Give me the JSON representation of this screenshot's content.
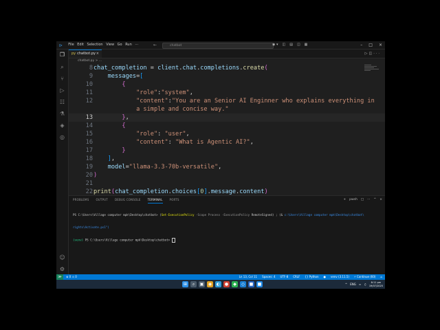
{
  "titlebar": {
    "menus": [
      "File",
      "Edit",
      "Selection",
      "View",
      "Go",
      "Run",
      "···"
    ],
    "nav": "← →",
    "search": "chatbot"
  },
  "activity_icons": [
    "files-icon",
    "search-icon",
    "source-control-icon",
    "run-debug-icon",
    "extensions-icon",
    "testing-icon",
    "python-icon",
    "remote-explorer-icon",
    "account-icon",
    "settings-icon"
  ],
  "tab": {
    "icon": "py",
    "label": "chatbot.py",
    "close": "×"
  },
  "breadcrumb": "chatbot.py > ...",
  "editor": {
    "lines": [
      {
        "num": "8",
        "segments": [
          [
            "chat_completion ",
            "#9cdcfe"
          ],
          [
            "= ",
            "#d4d4d4"
          ],
          [
            "client",
            "#9cdcfe"
          ],
          [
            ".",
            "#d4d4d4"
          ],
          [
            "chat",
            "#9cdcfe"
          ],
          [
            ".",
            "#d4d4d4"
          ],
          [
            "completions",
            "#9cdcfe"
          ],
          [
            ".",
            "#d4d4d4"
          ],
          [
            "create",
            "#dcdcaa"
          ],
          [
            "(",
            "#da70d6"
          ]
        ]
      },
      {
        "num": "9",
        "segments": [
          [
            "    messages",
            "#9cdcfe"
          ],
          [
            "=",
            "#d4d4d4"
          ],
          [
            "[",
            "#179fff"
          ]
        ]
      },
      {
        "num": "10",
        "segments": [
          [
            "        {",
            "#da70d6"
          ]
        ]
      },
      {
        "num": "11",
        "segments": [
          [
            "            ",
            "#d4d4d4"
          ],
          [
            "\"role\"",
            "#ce9178"
          ],
          [
            ":",
            "#d4d4d4"
          ],
          [
            "\"system\"",
            "#ce9178"
          ],
          [
            ",",
            "#d4d4d4"
          ]
        ]
      },
      {
        "num": "12",
        "segments": [
          [
            "            ",
            "#d4d4d4"
          ],
          [
            "\"content\"",
            "#ce9178"
          ],
          [
            ":",
            "#d4d4d4"
          ],
          [
            "\"You are an Senior AI Enginner who explains everything in",
            "#ce9178"
          ]
        ]
      },
      {
        "num": "",
        "segments": [
          [
            "            a simple and concise way.\"",
            "#ce9178"
          ]
        ]
      },
      {
        "num": "13",
        "segments": [
          [
            "        }",
            "#da70d6"
          ],
          [
            ",",
            "#d4d4d4"
          ]
        ],
        "current": true
      },
      {
        "num": "14",
        "segments": [
          [
            "        {",
            "#da70d6"
          ]
        ]
      },
      {
        "num": "15",
        "segments": [
          [
            "            ",
            "#d4d4d4"
          ],
          [
            "\"role\"",
            "#ce9178"
          ],
          [
            ": ",
            "#d4d4d4"
          ],
          [
            "\"user\"",
            "#ce9178"
          ],
          [
            ",",
            "#d4d4d4"
          ]
        ]
      },
      {
        "num": "16",
        "segments": [
          [
            "            ",
            "#d4d4d4"
          ],
          [
            "\"content\"",
            "#ce9178"
          ],
          [
            ": ",
            "#d4d4d4"
          ],
          [
            "\"What is Agentic AI?\"",
            "#ce9178"
          ],
          [
            ",",
            "#d4d4d4"
          ]
        ]
      },
      {
        "num": "17",
        "segments": [
          [
            "        }",
            "#da70d6"
          ]
        ]
      },
      {
        "num": "18",
        "segments": [
          [
            "    ]",
            "#179fff"
          ],
          [
            ",",
            "#d4d4d4"
          ]
        ]
      },
      {
        "num": "19",
        "segments": [
          [
            "    model",
            "#9cdcfe"
          ],
          [
            "=",
            "#d4d4d4"
          ],
          [
            "\"llama-3.3-70b-versatile\"",
            "#ce9178"
          ],
          [
            ",",
            "#d4d4d4"
          ]
        ]
      },
      {
        "num": "20",
        "segments": [
          [
            ")",
            "#da70d6"
          ]
        ]
      },
      {
        "num": "21",
        "segments": []
      },
      {
        "num": "22",
        "segments": [
          [
            "print",
            "#dcdcaa"
          ],
          [
            "(",
            "#da70d6"
          ],
          [
            "chat_completion",
            "#9cdcfe"
          ],
          [
            ".",
            "#d4d4d4"
          ],
          [
            "choices",
            "#9cdcfe"
          ],
          [
            "[",
            "#179fff"
          ],
          [
            "0",
            "#b5cea8"
          ],
          [
            "]",
            "#179fff"
          ],
          [
            ".",
            "#d4d4d4"
          ],
          [
            "message",
            "#9cdcfe"
          ],
          [
            ".",
            "#d4d4d4"
          ],
          [
            "content",
            "#9cdcfe"
          ],
          [
            ")",
            "#da70d6"
          ]
        ]
      }
    ]
  },
  "panel": {
    "tabs": [
      "PROBLEMS",
      "OUTPUT",
      "DEBUG CONSOLE",
      "TERMINAL",
      "PORTS"
    ],
    "active_tab": "TERMINAL",
    "actions": [
      "+",
      "pwsh",
      "□",
      "···",
      "^",
      "×"
    ],
    "terminal": {
      "l1_prompt": "PS C:\\Users\\Village computer mpk\\Desktop\\chatbot> ",
      "l1_cmd": "Set-ExecutionPolicy",
      "l1_args": " -Scope Process -ExecutionPolicy ",
      "l1_val": "RemoteSigned",
      "l1_mid": ") ; (& ",
      "l1_path": "c:\\Users\\Village computer mpk\\Desktop\\chatbot\\",
      "l2": "rights\\Activate.ps1\")",
      "l3_env": "(venv) ",
      "l3_prompt": "PS C:\\Users\\Village computer mpk\\Desktop\\chatbot> "
    }
  },
  "statusbar": {
    "remote": "≫",
    "left": "⊗ 0 ⚠ 0",
    "right": [
      "Ln 13, Col 11",
      "Spaces: 4",
      "UTF-8",
      "CRLF",
      "{} Python",
      "●",
      "venv (3.11.5)",
      "⚡ Continue (60)",
      "⌂"
    ]
  },
  "taskbar": {
    "items": [
      {
        "glyph": "⊞",
        "color": "#2b8fe8"
      },
      {
        "glyph": "⌕",
        "color": "#4a5a6a"
      },
      {
        "glyph": "▣",
        "color": "#4a5a6a"
      },
      {
        "glyph": "◉",
        "color": "#e0a020"
      },
      {
        "glyph": "◐",
        "color": "#2a9bd8"
      },
      {
        "glyph": "●",
        "color": "#d04030"
      },
      {
        "glyph": "◆",
        "color": "#2bb050"
      },
      {
        "glyph": "◇",
        "color": "#1a7fd4"
      },
      {
        "glyph": "■",
        "color": "#2563c0"
      },
      {
        "glyph": "■",
        "color": "#1e88e5"
      }
    ],
    "time": "8:11 pm",
    "date": "19/07/2025",
    "lang": "ENG"
  }
}
